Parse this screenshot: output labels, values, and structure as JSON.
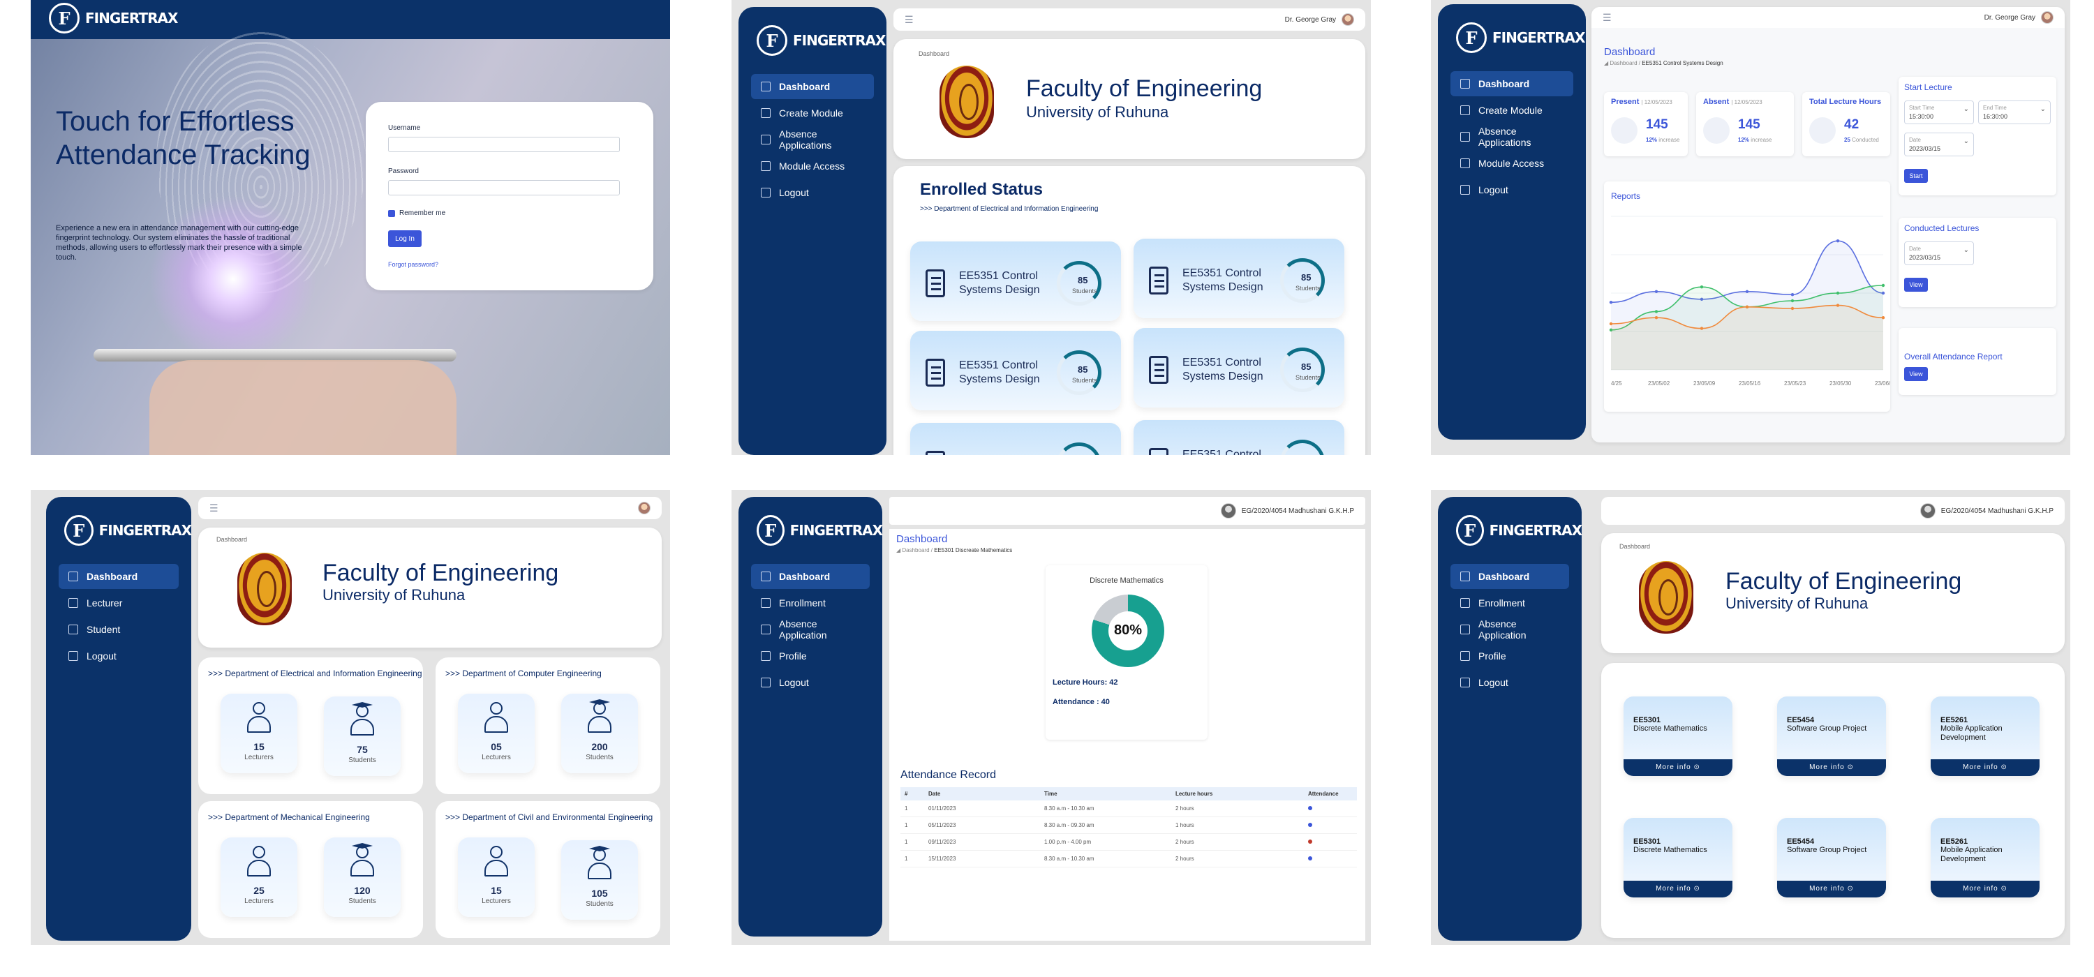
{
  "brand": {
    "logo_letter": "F",
    "name": "FINGERTRAX"
  },
  "colors": {
    "navy": "#0b3269",
    "accent": "#3b55d9",
    "teal": "#0d6f87",
    "present": "#3b55d9",
    "absent": "#c0392b"
  },
  "login": {
    "headline": "Touch for Effortless Attendance Tracking",
    "description": "Experience a new era in attendance management with our cutting-edge fingerprint technology. Our system eliminates the hassle of traditional methods, allowing users to effortlessly mark their presence with a simple touch.",
    "username_label": "Username",
    "password_label": "Password",
    "remember_label": "Remember me",
    "login_button": "Log In",
    "forgot_link": "Forgot password?"
  },
  "lecturer_nav": [
    "Dashboard",
    "Create Module",
    "Absence Applications",
    "Module Access",
    "Logout"
  ],
  "admin_nav": [
    "Dashboard",
    "Lecturer",
    "Student",
    "Logout"
  ],
  "student_nav": [
    "Dashboard",
    "Enrollment",
    "Absence Application",
    "Profile",
    "Logout"
  ],
  "faculty": {
    "title": "Faculty of Engineering",
    "subtitle": "University of Ruhuna",
    "breadcrumb": "Dashboard"
  },
  "lecturer_user": "Dr. George Gray",
  "student_user": "EG/2020/4054 Madhushani G.K.H.P",
  "enrolled": {
    "title": "Enrolled Status",
    "department": ">>> Department of Electrical and Information Engineering",
    "cards": [
      {
        "name": "EE5351 Control Systems Design",
        "count": "85",
        "unit": "Students"
      },
      {
        "name": "EE5351 Control Systems Design",
        "count": "85",
        "unit": "Students"
      },
      {
        "name": "EE5351 Control Systems Design",
        "count": "85",
        "unit": "Students"
      },
      {
        "name": "EE5351 Control Systems Design",
        "count": "85",
        "unit": "Students"
      },
      {
        "name": "",
        "count": "",
        "unit": ""
      },
      {
        "name": "EE5351 Control",
        "count": "",
        "unit": ""
      }
    ]
  },
  "module_dash": {
    "title": "Dashboard",
    "breadcrumb_root": "Dashboard /",
    "breadcrumb_current": "EE5351 Control Systems Design",
    "present": {
      "label": "Present",
      "date": "| 12/05/2023",
      "value": "145",
      "pct": "12%",
      "note": "increase"
    },
    "absent": {
      "label": "Absent",
      "date": "| 12/05/2023",
      "value": "145",
      "pct": "12%",
      "note": "increase"
    },
    "total": {
      "label": "Total Lecture Hours",
      "value": "42",
      "pct": "25",
      "note": "Conducted"
    },
    "reports_title": "Reports",
    "x_ticks": [
      "4/25",
      "23/05/02",
      "23/05/09",
      "23/05/16",
      "23/05/23",
      "23/05/30",
      "23/06/0"
    ],
    "start_title": "Start Lecture",
    "start_time_label": "Start Time",
    "start_time": "15:30:00",
    "end_time_label": "End Time",
    "end_time": "16:30:00",
    "date_label": "Date",
    "date_value": "2023/03/15",
    "start_button": "Start",
    "conducted_title": "Conducted Lectures",
    "view_button": "View",
    "overall_title": "Overall Attendance Report"
  },
  "chart_data": {
    "type": "area",
    "categories": [
      "4/25",
      "23/05/02",
      "23/05/09",
      "23/05/16",
      "23/05/23",
      "23/05/30",
      "23/06/0"
    ],
    "series": [
      {
        "name": "",
        "values": [
          44,
          51,
          46,
          51,
          49,
          84,
          50
        ],
        "color": "#5b6fe0"
      },
      {
        "name": "",
        "values": [
          26,
          38,
          54,
          41,
          45,
          50,
          55
        ],
        "color": "#3fbf6b"
      },
      {
        "name": "",
        "values": [
          30,
          34,
          27,
          41,
          40,
          42,
          34
        ],
        "color": "#f08a3c"
      }
    ],
    "ylim": [
      0,
      100
    ],
    "grid": true
  },
  "admin": {
    "departments": [
      {
        "title": ">>> Department of Electrical and Information Engineering",
        "lecturers": "15",
        "students": "75"
      },
      {
        "title": ">>> Department of Computer Engineering",
        "lecturers": "05",
        "students": "200"
      },
      {
        "title": ">>> Department of Mechanical Engineering",
        "lecturers": "25",
        "students": "120"
      },
      {
        "title": ">>> Department of Civil and Environmental Engineering",
        "lecturers": "15",
        "students": "105"
      }
    ],
    "lecturers_label": "Lecturers",
    "students_label": "Students"
  },
  "student_module": {
    "title": "Dashboard",
    "breadcrumb_root": "Dashboard /",
    "breadcrumb_current": "EE5301 Discreate Mathematics",
    "card_title": "Discrete Mathematics",
    "percent": "80%",
    "percent_value": 80,
    "lecture_hours": "Lecture Hours: 42",
    "attendance": "Attendance : 40",
    "record_title": "Attendance Record",
    "columns": [
      "#",
      "Date",
      "Time",
      "Lecture hours",
      "Attendance"
    ],
    "rows": [
      {
        "n": "1",
        "date": "01/11/2023",
        "time": "8.30 a.m - 10.30 am",
        "hours": "2 hours",
        "status": "present"
      },
      {
        "n": "1",
        "date": "05/11/2023",
        "time": "8.30 a.m - 09.30 am",
        "hours": "1 hours",
        "status": "present"
      },
      {
        "n": "1",
        "date": "09/11/2023",
        "time": "1.00 p.m - 4.00 pm",
        "hours": "2 hours",
        "status": "absent"
      },
      {
        "n": "1",
        "date": "15/11/2023",
        "time": "8.30 a.m - 10.30 am",
        "hours": "2 hours",
        "status": "present"
      }
    ]
  },
  "modules": [
    {
      "code": "EE5301",
      "name": "Discrete Mathematics"
    },
    {
      "code": "EE5454",
      "name": "Software Group Project"
    },
    {
      "code": "EE5261",
      "name": "Mobile Application Development"
    },
    {
      "code": "EE5301",
      "name": "Discrete Mathematics"
    },
    {
      "code": "EE5454",
      "name": "Software Group Project"
    },
    {
      "code": "EE5261",
      "name": "Mobile Application Development"
    }
  ],
  "more_info": "More info"
}
